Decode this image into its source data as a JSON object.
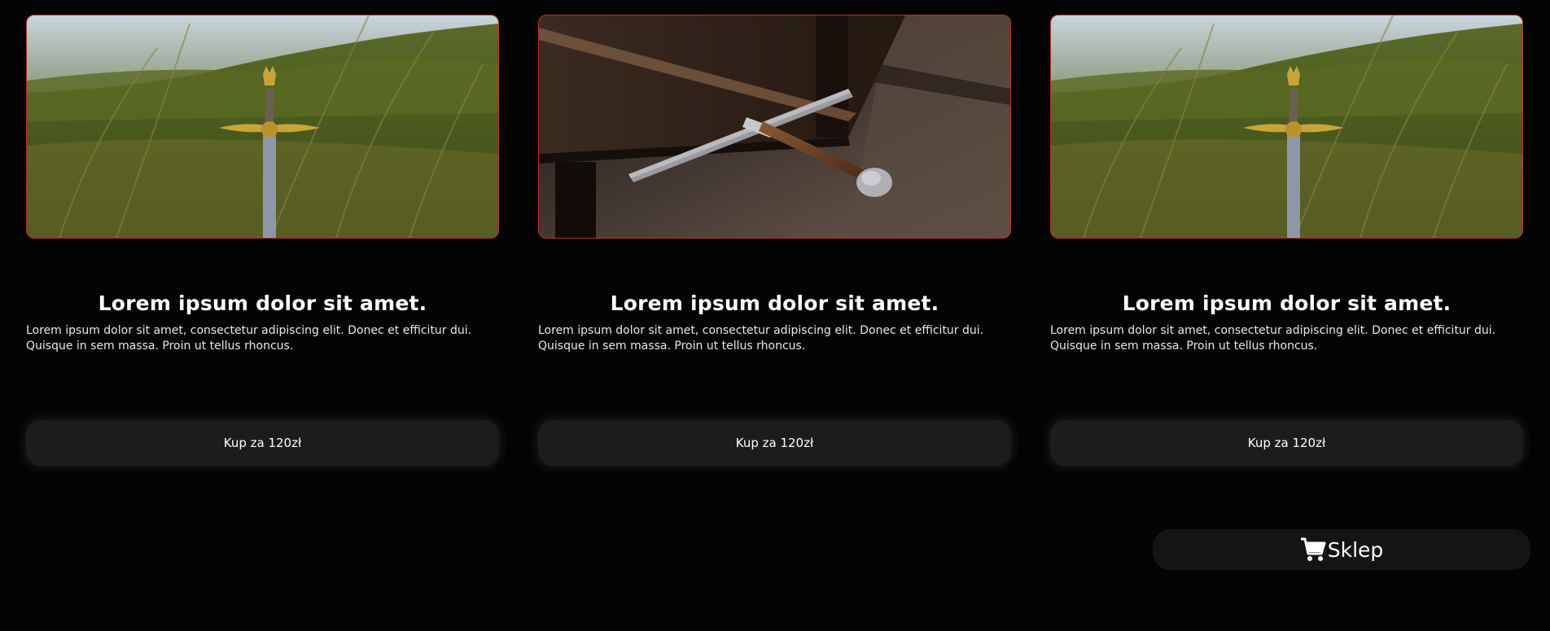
{
  "cards": [
    {
      "image": "sword-in-grass-photo",
      "title": "Lorem ipsum dolor sit amet.",
      "description": "Lorem ipsum dolor sit amet, consectetur adipiscing elit. Donec et efficitur dui. Quisque in sem massa. Proin ut tellus rhoncus.",
      "button_label": "Kup za 120zł"
    },
    {
      "image": "sword-on-table-photo",
      "title": "Lorem ipsum dolor sit amet.",
      "description": "Lorem ipsum dolor sit amet, consectetur adipiscing elit. Donec et efficitur dui. Quisque in sem massa. Proin ut tellus rhoncus.",
      "button_label": "Kup za 120zł"
    },
    {
      "image": "sword-in-grass-photo",
      "title": "Lorem ipsum dolor sit amet.",
      "description": "Lorem ipsum dolor sit amet, consectetur adipiscing elit. Donec et efficitur dui. Quisque in sem massa. Proin ut tellus rhoncus.",
      "button_label": "Kup za 120zł"
    }
  ],
  "shop": {
    "label": "Sklep",
    "icon": "cart-icon"
  },
  "colors": {
    "background": "#040404",
    "image_border": "#c32a2a",
    "button_bg": "#1c1c1c",
    "text": "#ffffff"
  }
}
